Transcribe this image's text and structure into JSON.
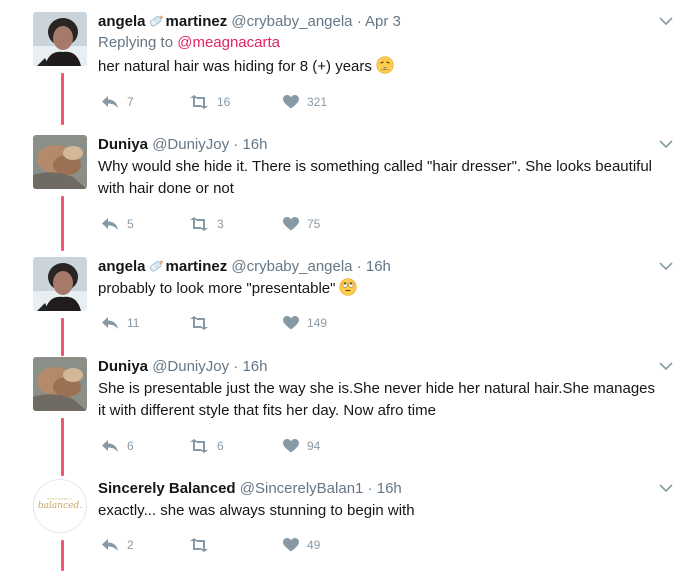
{
  "thread": {
    "line_color": "#f0576d",
    "link_color": "#e0245e"
  },
  "tweets": [
    {
      "name_first": "angela",
      "name_last": "martinez",
      "name_icon": "baby-bottle-icon",
      "handle": "@crybaby_angela",
      "time": "Apr 3",
      "reply_label": "Replying to",
      "reply_handle": "@meagnacarta",
      "text": "her natural hair was hiding for 8 (+) years",
      "emoji": "weary-face-emoji",
      "replies": "7",
      "retweets": "16",
      "likes": "321"
    },
    {
      "name": "Duniya",
      "handle": "@DuniyJoy",
      "time": "16h",
      "text": "Why would she hide it.  There is something called \"hair dresser\".  She looks beautiful with hair done or not",
      "replies": "5",
      "retweets": "3",
      "likes": "75"
    },
    {
      "name_first": "angela",
      "name_last": "martinez",
      "name_icon": "baby-bottle-icon",
      "handle": "@crybaby_angela",
      "time": "16h",
      "text": "probably to look more \"presentable\"",
      "emoji": "rolling-eyes-emoji",
      "replies": "11",
      "retweets": "",
      "likes": "149"
    },
    {
      "name": "Duniya",
      "handle": "@DuniyJoy",
      "time": "16h",
      "text": "She is presentable just the way she is.She never hide her natural hair.She manages it with different style that fits her day. Now afro time",
      "replies": "6",
      "retweets": "6",
      "likes": "94"
    },
    {
      "name": "Sincerely Balanced",
      "handle": "@SincerelyBalan1",
      "time": "16h",
      "avatar_text": "balanced.",
      "avatar_small": "SINCERELY",
      "text": "exactly... she was always stunning to begin with",
      "replies": "2",
      "retweets": "",
      "likes": "49"
    }
  ]
}
